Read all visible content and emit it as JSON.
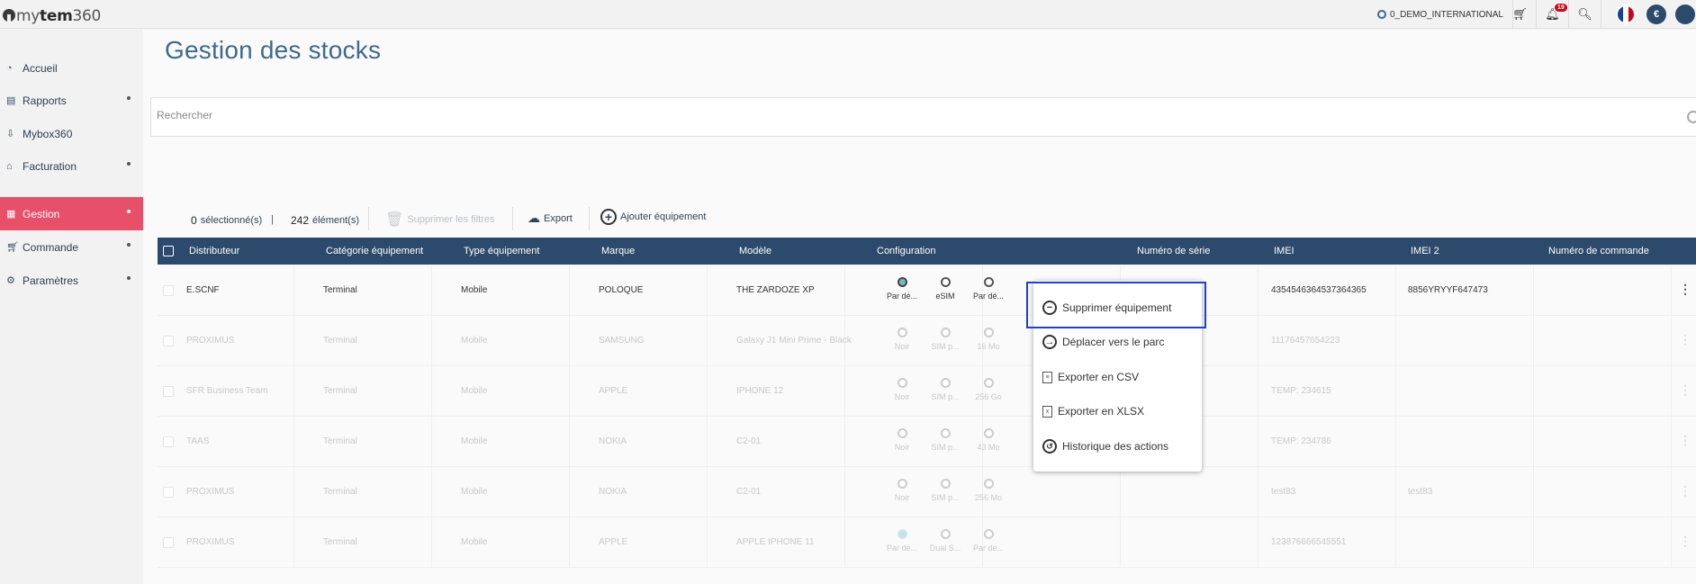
{
  "app": {
    "logo_light": "my",
    "logo_bold": "tem",
    "logo_num": "360"
  },
  "topbar": {
    "org": "0_DEMO_INTERNATIONAL",
    "notif_count": "19",
    "currency": "€"
  },
  "sidebar": {
    "items": [
      {
        "label": "Accueil",
        "icon": "dashboard-icon"
      },
      {
        "label": "Rapports",
        "icon": "report-icon"
      },
      {
        "label": "Mybox360",
        "icon": "inbox-icon"
      },
      {
        "label": "Facturation",
        "icon": "bank-icon"
      },
      {
        "label": "Gestion",
        "icon": "grid-icon"
      },
      {
        "label": "Commande",
        "icon": "cart-icon"
      },
      {
        "label": "Paramètres",
        "icon": "gear-icon"
      }
    ]
  },
  "page": {
    "title": "Gestion des stocks"
  },
  "search": {
    "placeholder": "Rechercher"
  },
  "toolbar": {
    "selected_count": "0",
    "selected_label": "sélectionné(s)",
    "sep": "|",
    "total_count": "242",
    "total_label": "élément(s)",
    "clear_filters": "Supprimer les filtres",
    "export": "Export",
    "add": "Ajouter équipement"
  },
  "table": {
    "headers": [
      "Distributeur",
      "Catégorie équipement",
      "Type équipement",
      "Marque",
      "Modèle",
      "Configuration",
      "Numéro de série",
      "IMEI",
      "IMEI 2",
      "Numéro de commande"
    ],
    "rows": [
      {
        "distributeur": "E.SCNF",
        "categorie": "Terminal",
        "type": "Mobile",
        "marque": "POLOQUE",
        "modele": "THE ZARDOZE XP",
        "cfg": [
          "Par dé...",
          "eSIM",
          "Par dé..."
        ],
        "serie": "",
        "imei": "4354546364537364365",
        "imei2": "8856YRYYF647473",
        "commande": ""
      },
      {
        "distributeur": "PROXIMUS",
        "categorie": "Terminal",
        "type": "Mobile",
        "marque": "SAMSUNG",
        "modele": "Galaxy J1 Mini Prime - Black",
        "cfg": [
          "Noir",
          "SIM p...",
          "16 Mo"
        ],
        "serie": "",
        "imei": "11176457654223",
        "imei2": "",
        "commande": ""
      },
      {
        "distributeur": "SFR Business Team",
        "categorie": "Terminal",
        "type": "Mobile",
        "marque": "APPLE",
        "modele": "IPHONE 12",
        "cfg": [
          "Noir",
          "SIM p...",
          "256 Go"
        ],
        "serie": "",
        "imei": "TEMP: 234615",
        "imei2": "",
        "commande": ""
      },
      {
        "distributeur": "TAAS",
        "categorie": "Terminal",
        "type": "Mobile",
        "marque": "NOKIA",
        "modele": "C2-01",
        "cfg": [
          "Noir",
          "SIM p...",
          "43 Mo"
        ],
        "serie": "",
        "imei": "TEMP: 234786",
        "imei2": "",
        "commande": ""
      },
      {
        "distributeur": "PROXIMUS",
        "categorie": "Terminal",
        "type": "Mobile",
        "marque": "NOKIA",
        "modele": "C2-01",
        "cfg": [
          "Noir",
          "SIM p...",
          "256 Mo"
        ],
        "serie": "",
        "imei": "test83",
        "imei2": "test83",
        "commande": ""
      },
      {
        "distributeur": "PROXIMUS",
        "categorie": "Terminal",
        "type": "Mobile",
        "marque": "APPLE",
        "modele": "APPLE IPHONE 11",
        "cfg": [
          "Par dé...",
          "Dual S...",
          "Par dé..."
        ],
        "serie": "",
        "imei": "123876666545551",
        "imei2": "",
        "commande": ""
      }
    ]
  },
  "context_menu": {
    "items": [
      {
        "label": "Supprimer équipement",
        "icon": "minus-circle-icon"
      },
      {
        "label": "Déplacer vers le parc",
        "icon": "arrow-circle-icon"
      },
      {
        "label": "Exporter en CSV",
        "icon": "csv-file-icon"
      },
      {
        "label": "Exporter en XLSX",
        "icon": "xlsx-file-icon"
      },
      {
        "label": "Historique des actions",
        "icon": "history-icon"
      }
    ]
  }
}
